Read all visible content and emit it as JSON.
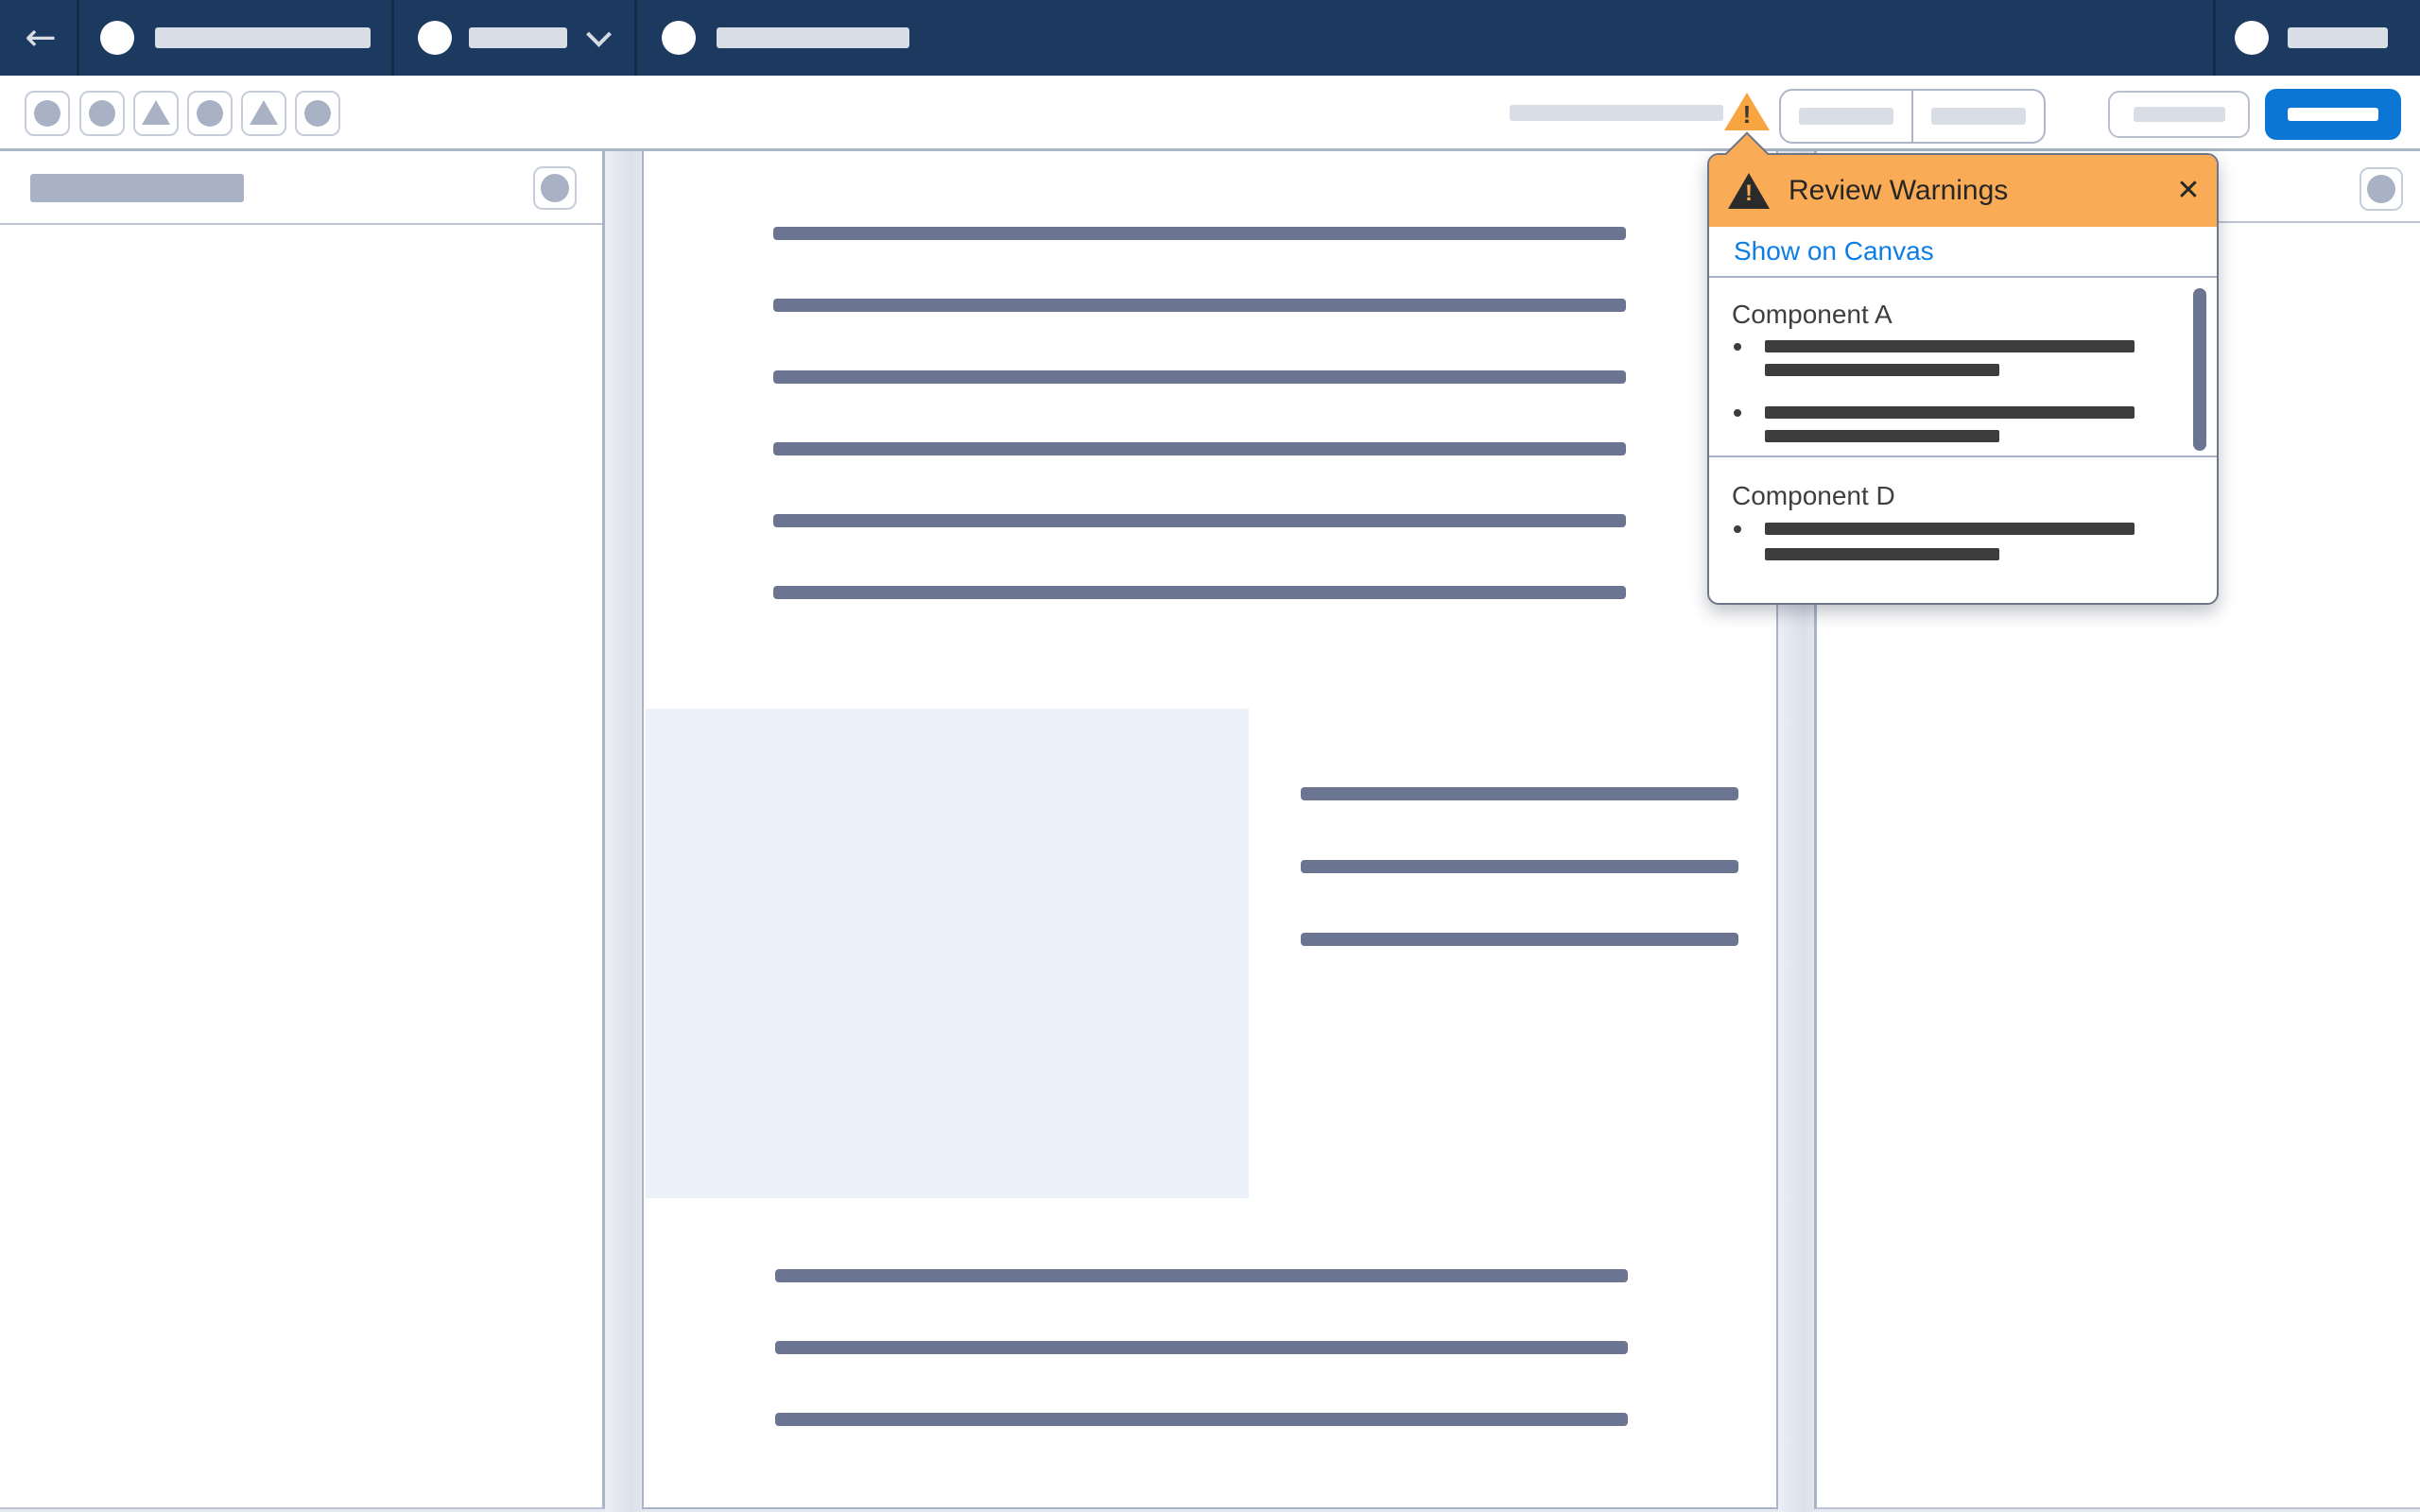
{
  "global_nav": {
    "back_icon": "←",
    "items": [
      {
        "name": "primary-app-menu",
        "icon": "avatar-circle-icon"
      },
      {
        "name": "context-dropdown",
        "icon": "avatar-circle-icon",
        "chevron": "chevron-down-icon"
      },
      {
        "name": "secondary-menu",
        "icon": "avatar-circle-icon"
      }
    ],
    "user": {
      "icon": "avatar-circle-icon"
    }
  },
  "toolbar": {
    "left_buttons": [
      {
        "icon": "circle-icon"
      },
      {
        "icon": "circle-icon"
      },
      {
        "icon": "triangle-icon"
      },
      {
        "icon": "circle-icon"
      },
      {
        "icon": "triangle-icon"
      },
      {
        "icon": "circle-icon"
      }
    ],
    "warning": {
      "icon": "warning-triangle-icon",
      "exclamation": "!"
    }
  },
  "popover": {
    "title": "Review Warnings",
    "warning_icon": "warning-triangle-icon",
    "warning_exclamation": "!",
    "close_icon": "✕",
    "link_label": "Show on Canvas",
    "sections": [
      {
        "title": "Component A",
        "bullet_count": 2
      },
      {
        "title": "Component D",
        "bullet_count": 1
      }
    ]
  },
  "colors": {
    "nav_navy": "#1C3A5F",
    "popover_header_orange": "#F9AB55",
    "warning_orange": "#F7A441",
    "primary_blue": "#0B76D4",
    "link_blue": "#0D7EE5",
    "greek_slate": "#6B7490",
    "greek_dark": "#3D3D3D",
    "placeholder_gray": "#D8DDE6",
    "icon_gray": "#A9B2C4"
  }
}
